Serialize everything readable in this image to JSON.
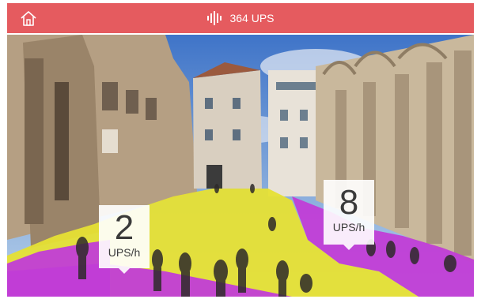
{
  "header": {
    "ups_text": "364 UPS",
    "background_color": "#e55b5f",
    "home_icon": "home-icon",
    "activity_icon": "pulse-bars-icon"
  },
  "zones": [
    {
      "name": "left-zone",
      "value": "2",
      "unit": "UPS/h",
      "color": "#e6e034"
    },
    {
      "name": "right-zone",
      "value": "8",
      "unit": "UPS/h",
      "color": "#c13dd6"
    }
  ]
}
